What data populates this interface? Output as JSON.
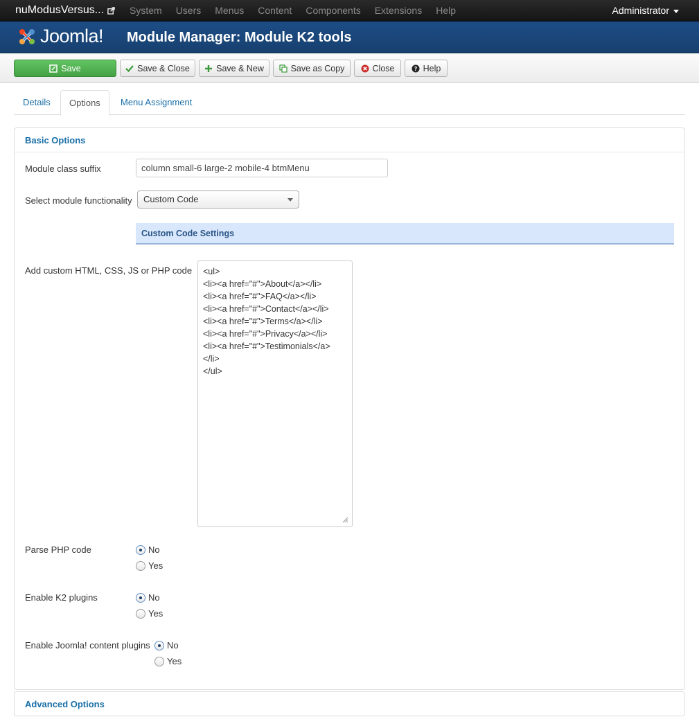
{
  "navbar": {
    "site_name": "nuModusVersus...",
    "menu": [
      "System",
      "Users",
      "Menus",
      "Content",
      "Components",
      "Extensions",
      "Help"
    ],
    "user": "Administrator"
  },
  "header": {
    "logo_text": "Joomla!",
    "title": "Module Manager: Module K2 tools"
  },
  "toolbar": {
    "save": "Save",
    "save_close": "Save & Close",
    "save_new": "Save & New",
    "save_copy": "Save as Copy",
    "close": "Close",
    "help": "Help"
  },
  "tabs": [
    "Details",
    "Options",
    "Menu Assignment"
  ],
  "active_tab": "Options",
  "basic": {
    "heading": "Basic Options",
    "class_suffix_label": "Module class suffix",
    "class_suffix_value": "column small-6 large-2 mobile-4 btmMenu",
    "functionality_label": "Select module functionality",
    "functionality_value": "Custom Code",
    "custom_code_heading": "Custom Code Settings",
    "custom_code_label": "Add custom HTML, CSS, JS or PHP code",
    "custom_code_lines": [
      "<ul>",
      "<li><a href=\"#\">About</a></li>",
      "<li><a href=\"#\">FAQ</a></li>",
      "<li><a href=\"#\">Contact</a></li>",
      "<li><a href=\"#\">Terms</a></li>",
      "<li><a href=\"#\">Privacy</a></li>",
      "<li><a href=\"#\">Testimonials</a>",
      "</li>",
      "</ul>"
    ],
    "parse_php_label": "Parse PHP code",
    "k2_plugins_label": "Enable K2 plugins",
    "joomla_plugins_label": "Enable Joomla! content plugins",
    "no": "No",
    "yes": "Yes",
    "parse_php_value": "No",
    "k2_plugins_value": "No",
    "joomla_plugins_value": "No"
  },
  "advanced": {
    "heading": "Advanced Options"
  },
  "colors": {
    "navbar": "#1b1b1b",
    "header": "#1b4a80",
    "save_button": "#51b351",
    "link": "#1a6fa8",
    "subsection": "#d8e7fb"
  }
}
